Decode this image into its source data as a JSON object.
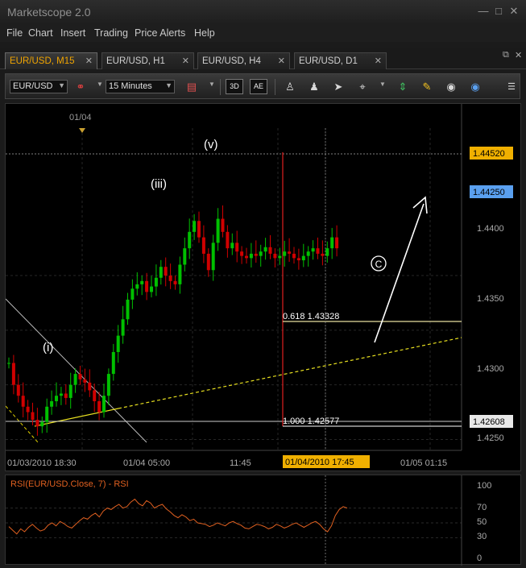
{
  "window": {
    "title": "Marketscope 2.0"
  },
  "menu": [
    "File",
    "Chart",
    "Insert",
    "Trading",
    "Price Alerts",
    "Help"
  ],
  "tabs": [
    {
      "label": "EUR/USD, M15",
      "active": true
    },
    {
      "label": "EUR/USD, H1",
      "active": false
    },
    {
      "label": "EUR/USD, H4",
      "active": false
    },
    {
      "label": "EUR/USD, D1",
      "active": false
    }
  ],
  "toolbar": {
    "instrument": "EUR/USD",
    "timeframe": "15 Minutes",
    "btn1": "3D",
    "btn2": "AE"
  },
  "chart": {
    "date_marker": "01/04",
    "wave_labels": {
      "w1": "(i)",
      "w3": "(iii)",
      "w5": "(v)",
      "wc": "C"
    },
    "fib_618": "0.618 1.43328",
    "fib_1000": "1.000 1.42577",
    "price_ticks": [
      "1.4400",
      "1.4350",
      "1.4300",
      "1.4250"
    ],
    "price_labels": {
      "high": "1.44520",
      "current": "1.44250",
      "low": "1.42608"
    },
    "time_labels": [
      "01/03/2010 18:30",
      "01/04 05:00",
      "11:45",
      "01/05 01:15"
    ],
    "time_highlight": "01/04/2010 17:45",
    "colors": {
      "bull": "#00c000",
      "bear": "#d00000",
      "highlight": "#f0b000",
      "current": "#5aa0f0",
      "rsi": "#e06020"
    }
  },
  "rsi": {
    "title": "RSI(EUR/USD.Close, 7) - RSI",
    "ticks": [
      "100",
      "70",
      "50",
      "30",
      "0"
    ]
  },
  "chart_data": {
    "type": "candlestick",
    "instrument": "EUR/USD",
    "timeframe": "M15",
    "ylim": [
      1.424,
      1.4535
    ],
    "fib_levels": [
      {
        "ratio": 0.618,
        "price": 1.43328
      },
      {
        "ratio": 1.0,
        "price": 1.42577
      }
    ],
    "price_series": [
      1.432,
      1.43,
      1.429,
      1.428,
      1.4275,
      1.4268,
      1.4262,
      1.4266,
      1.428,
      1.4285,
      1.429,
      1.4292,
      1.4288,
      1.43,
      1.431,
      1.4305,
      1.4302,
      1.4295,
      1.4285,
      1.4275,
      1.429,
      1.431,
      1.433,
      1.4345,
      1.436,
      1.4378,
      1.4388,
      1.4392,
      1.4395,
      1.4385,
      1.439,
      1.4398,
      1.4408,
      1.44,
      1.4395,
      1.4392,
      1.441,
      1.4425,
      1.444,
      1.445,
      1.4435,
      1.442,
      1.4405,
      1.443,
      1.4452,
      1.444,
      1.4425,
      1.443,
      1.4422,
      1.4418,
      1.4416,
      1.442,
      1.4418,
      1.4422,
      1.4426,
      1.442,
      1.4416,
      1.4418,
      1.4422,
      1.442,
      1.4416,
      1.4414,
      1.4418,
      1.4422,
      1.4425,
      1.442,
      1.4418,
      1.4425,
      1.4435,
      1.4425
    ],
    "rsi_values": [
      45,
      40,
      35,
      42,
      38,
      44,
      48,
      43,
      39,
      41,
      47,
      50,
      46,
      52,
      49,
      45,
      43,
      48,
      53,
      57,
      55,
      60,
      63,
      58,
      66,
      70,
      68,
      72,
      75,
      70,
      72,
      78,
      82,
      76,
      73,
      80,
      77,
      70,
      73,
      75,
      69,
      65,
      60,
      57,
      61,
      58,
      53,
      55,
      50,
      49,
      48,
      45,
      47,
      50,
      48,
      46,
      50,
      52,
      49,
      47,
      43,
      42,
      45,
      48,
      47,
      45,
      42,
      44,
      48,
      46,
      43,
      45,
      48,
      50,
      47,
      44,
      47,
      50,
      52,
      48,
      42,
      38,
      46,
      60,
      68,
      72,
      70
    ]
  }
}
